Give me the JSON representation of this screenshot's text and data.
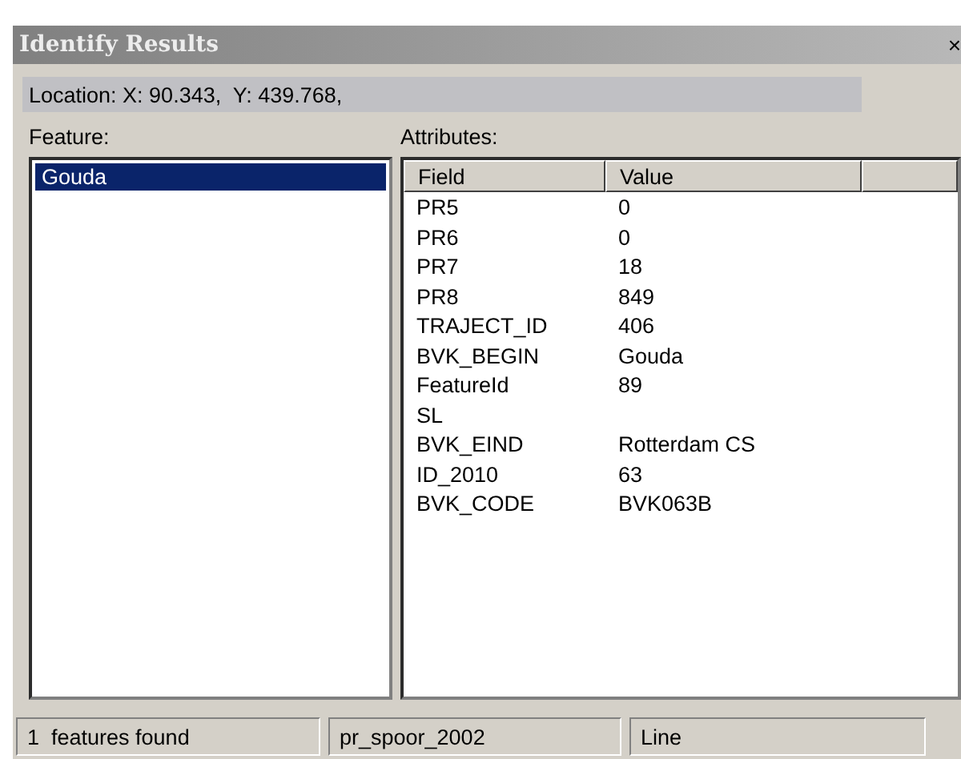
{
  "window": {
    "title": "Identify Results",
    "close": "×"
  },
  "location": "Location: X: 90.343,  Y: 439.768,",
  "feature_label": "Feature:",
  "attributes_label": "Attributes:",
  "features": [
    {
      "label": "Gouda",
      "selected": true
    }
  ],
  "table": {
    "columns": [
      "Field",
      "Value"
    ],
    "rows": [
      [
        "PR5",
        "0"
      ],
      [
        "PR6",
        "0"
      ],
      [
        "PR7",
        "18"
      ],
      [
        "PR8",
        "849"
      ],
      [
        "TRAJECT_ID",
        "406"
      ],
      [
        "BVK_BEGIN",
        "Gouda"
      ],
      [
        "FeatureId",
        "89"
      ],
      [
        "SL",
        ""
      ],
      [
        "BVK_EIND",
        "Rotterdam CS"
      ],
      [
        "ID_2010",
        "63"
      ],
      [
        "BVK_CODE",
        "BVK063B"
      ]
    ]
  },
  "status_bar": [
    "1  features found",
    "pr_spoor_2002",
    "Line"
  ]
}
